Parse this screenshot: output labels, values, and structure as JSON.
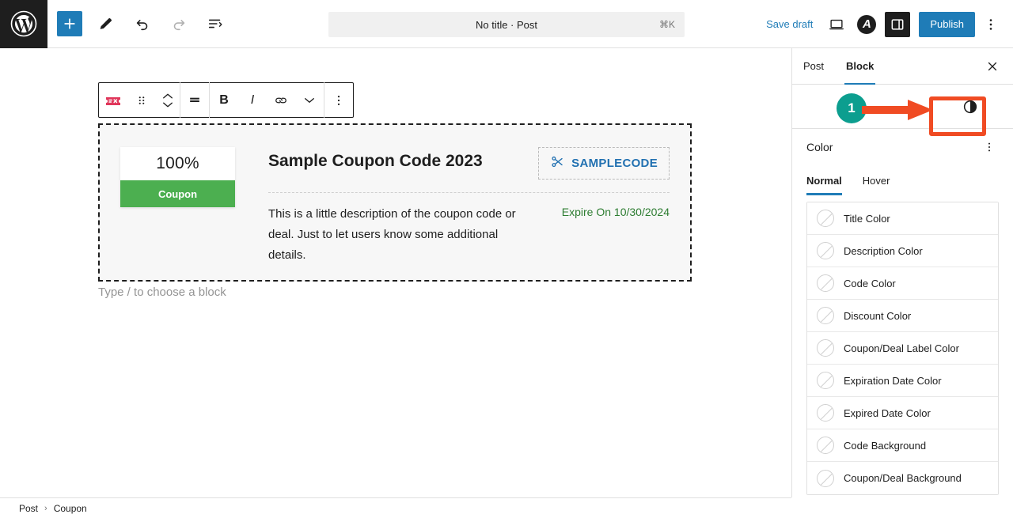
{
  "topbar": {
    "logo_icon": "wordpress-logo-icon",
    "add_block_label": "+",
    "add_block_icon": "plus-icon",
    "tools_icon": "pencil-edit-icon",
    "undo_icon": "undo-arrow-icon",
    "redo_icon": "redo-arrow-icon",
    "list_view_icon": "document-outline-icon",
    "document_title": "No title · Post",
    "shortcut_hint": "⌘K",
    "save_draft_label": "Save draft",
    "preview_icon": "laptop-preview-icon",
    "jetpack_icon": "jetpack-badge-icon",
    "jetpack_glyph": "A",
    "sidebar_toggle_icon": "settings-sidebar-icon",
    "publish_label": "Publish",
    "options_icon": "vertical-ellipsis-icon"
  },
  "block_toolbar": {
    "block_type_icon": "coupon-block-icon",
    "drag_icon": "drag-handle-icon",
    "move_up_icon": "chevron-up-icon",
    "move_down_icon": "chevron-down-icon",
    "align_icon": "align-justify-icon",
    "bold_label": "B",
    "italic_label": "I",
    "link_icon": "link-icon",
    "more_formats_icon": "chevron-down-icon",
    "options_icon": "vertical-ellipsis-icon"
  },
  "coupon": {
    "discount_value": "100%",
    "discount_label": "Coupon",
    "title": "Sample Coupon Code 2023",
    "code": "SAMPLECODE",
    "code_icon": "scissors-icon",
    "description": "This is a little description of the coupon code or deal. Just to let users know some additional details.",
    "expire_text": "Expire On 10/30/2024",
    "colors": {
      "label_background": "#4caf50",
      "code_text": "#2271b1",
      "expire_text": "#2e7d32",
      "block_background": "#f7f7f7"
    }
  },
  "canvas": {
    "placeholder": "Type / to choose a block"
  },
  "sidebar": {
    "tabs": [
      {
        "label": "Post",
        "active": false
      },
      {
        "label": "Block",
        "active": true
      }
    ],
    "close_icon": "close-x-icon",
    "contrast_icon": "color-contrast-icon",
    "annotation": {
      "step_number": "1",
      "circle_color": "#0c9e8f",
      "arrow_color": "#f04b23",
      "highlight_color": "#f04b23"
    },
    "section": {
      "title": "Color",
      "kebab_icon": "vertical-ellipsis-icon"
    },
    "state_tabs": [
      {
        "label": "Normal",
        "active": true
      },
      {
        "label": "Hover",
        "active": false
      }
    ],
    "color_rows": [
      {
        "label": "Title Color",
        "swatch_icon": "empty-color-swatch-icon"
      },
      {
        "label": "Description Color",
        "swatch_icon": "empty-color-swatch-icon"
      },
      {
        "label": "Code Color",
        "swatch_icon": "empty-color-swatch-icon"
      },
      {
        "label": "Discount Color",
        "swatch_icon": "empty-color-swatch-icon"
      },
      {
        "label": "Coupon/Deal Label Color",
        "swatch_icon": "empty-color-swatch-icon"
      },
      {
        "label": "Expiration Date Color",
        "swatch_icon": "empty-color-swatch-icon"
      },
      {
        "label": "Expired Date Color",
        "swatch_icon": "empty-color-swatch-icon"
      },
      {
        "label": "Code Background",
        "swatch_icon": "empty-color-swatch-icon"
      },
      {
        "label": "Coupon/Deal Background",
        "swatch_icon": "empty-color-swatch-icon"
      }
    ]
  },
  "breadcrumb": {
    "items": [
      "Post",
      "Coupon"
    ],
    "separator": "›"
  }
}
